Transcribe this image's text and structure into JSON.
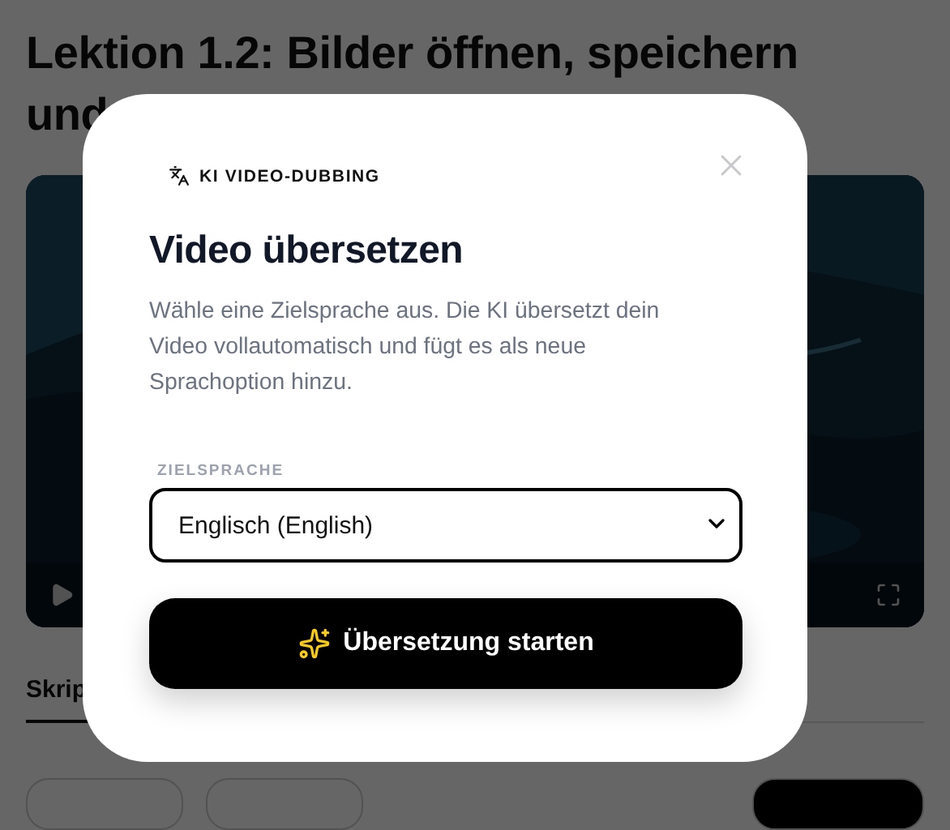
{
  "page": {
    "title": "Lektion 1.2: Bilder öffnen, speichern und",
    "tabs": [
      {
        "label": "Skrip",
        "selected": true
      }
    ]
  },
  "dialog": {
    "badge": "KI VIDEO-DUBBING",
    "title": "Video übersetzen",
    "description": "Wähle eine Zielsprache aus. Die KI übersetzt dein Video vollautomatisch und fügt es als neue Sprachoption hinzu.",
    "field_label": "ZIELSPRACHE",
    "select": {
      "value": "Englisch (English)"
    },
    "submit": "Übersetzung starten"
  }
}
